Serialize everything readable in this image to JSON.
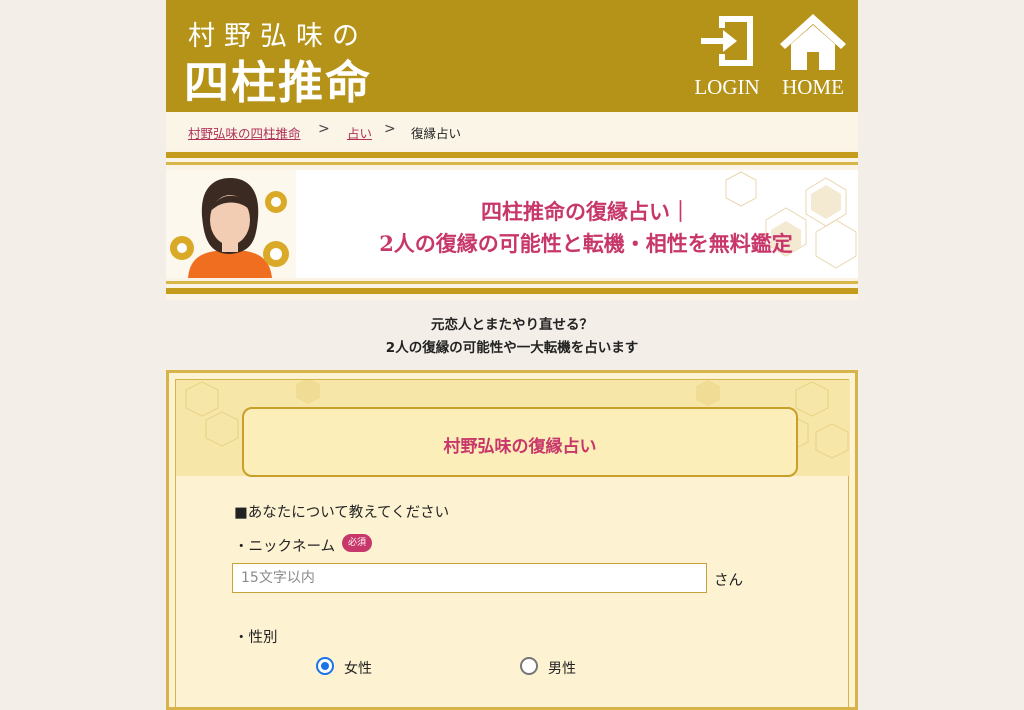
{
  "header": {
    "logo_sub": "村野弘味の",
    "logo_main": "四柱推命",
    "login_label": "LOGIN",
    "home_label": "HOME"
  },
  "breadcrumb": {
    "items": [
      "村野弘味の四柱推命",
      "占い"
    ],
    "current": "復縁占い",
    "separator": ">"
  },
  "banner": {
    "title_line1": "四柱推命の復縁占い｜",
    "title_line2": "2人の復縁の可能性と転機・相性を無料鑑定"
  },
  "intro": {
    "line1": "元恋人とまたやり直せる？",
    "line2": "2人の復縁の可能性や一大転機を占います"
  },
  "form": {
    "card_title": "村野弘味の復縁占い",
    "section_heading": "■あなたについて教えてください",
    "nickname_label": "・ニックネーム",
    "required_badge": "必須",
    "nickname_placeholder": "15文字以内",
    "nickname_value": "",
    "suffix": "さん",
    "gender_label": "・性別",
    "gender_options": [
      "女性",
      "男性"
    ],
    "gender_selected": "女性"
  },
  "colors": {
    "gold": "#b59218",
    "accent_pink": "#c8376a",
    "radio_blue": "#1a73e8"
  }
}
